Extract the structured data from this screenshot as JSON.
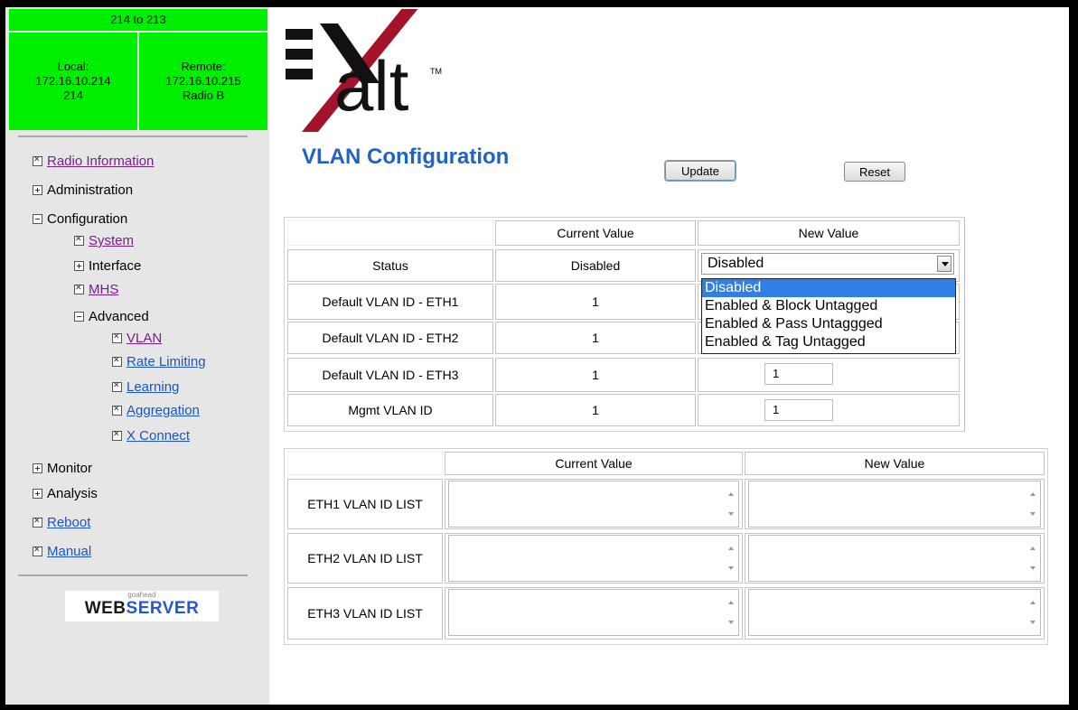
{
  "connection": {
    "title": "214 to 213",
    "local_label": "Local:",
    "local_ip": "172.16.10.214",
    "local_id": "214",
    "remote_label": "Remote:",
    "remote_ip": "172.16.10.215",
    "remote_name": "Radio B"
  },
  "nav": {
    "radio_information": "Radio Information",
    "administration": "Administration",
    "configuration": "Configuration",
    "system": "System",
    "interface": "Interface",
    "mhs": "MHS",
    "advanced": "Advanced",
    "vlan": "VLAN",
    "rate_limiting": "Rate Limiting",
    "learning": "Learning",
    "aggregation": "Aggregation",
    "x_connect": "X Connect",
    "monitor": "Monitor",
    "analysis": "Analysis",
    "reboot": "Reboot",
    "manual": "Manual"
  },
  "footer_logo": {
    "small": "goahead",
    "web": "WEB",
    "server": "SERVER"
  },
  "brand": {
    "text": "alt",
    "tm": "TM"
  },
  "page": {
    "title": "VLAN Configuration",
    "update_label": "Update",
    "reset_label": "Reset"
  },
  "table1": {
    "headers": [
      "Current Value",
      "New Value"
    ],
    "rows": [
      {
        "label": "Status",
        "current": "Disabled",
        "new": "Disabled"
      },
      {
        "label": "Default VLAN ID - ETH1",
        "current": "1",
        "new": ""
      },
      {
        "label": "Default VLAN ID - ETH2",
        "current": "1",
        "new": ""
      },
      {
        "label": "Default VLAN ID - ETH3",
        "current": "1",
        "new": "1"
      },
      {
        "label": "Mgmt VLAN ID",
        "current": "1",
        "new": "1"
      }
    ],
    "status_options": [
      "Disabled",
      "Enabled & Block Untagged",
      "Enabled & Pass Untaggged",
      "Enabled & Tag Untagged"
    ]
  },
  "table2": {
    "headers": [
      "Current Value",
      "New Value"
    ],
    "rows": [
      {
        "label": "ETH1 VLAN ID LIST",
        "current": "",
        "new": ""
      },
      {
        "label": "ETH2 VLAN ID LIST",
        "current": "",
        "new": ""
      },
      {
        "label": "ETH3 VLAN ID LIST",
        "current": "",
        "new": ""
      }
    ]
  },
  "colors": {
    "connection_bg": "#00ee00",
    "title_blue": "#2362c4",
    "link_blue": "#1a55c5",
    "link_visited": "#7a1e8e",
    "dropdown_highlight": "#2f7fe6",
    "logo_red": "#a3142a"
  }
}
